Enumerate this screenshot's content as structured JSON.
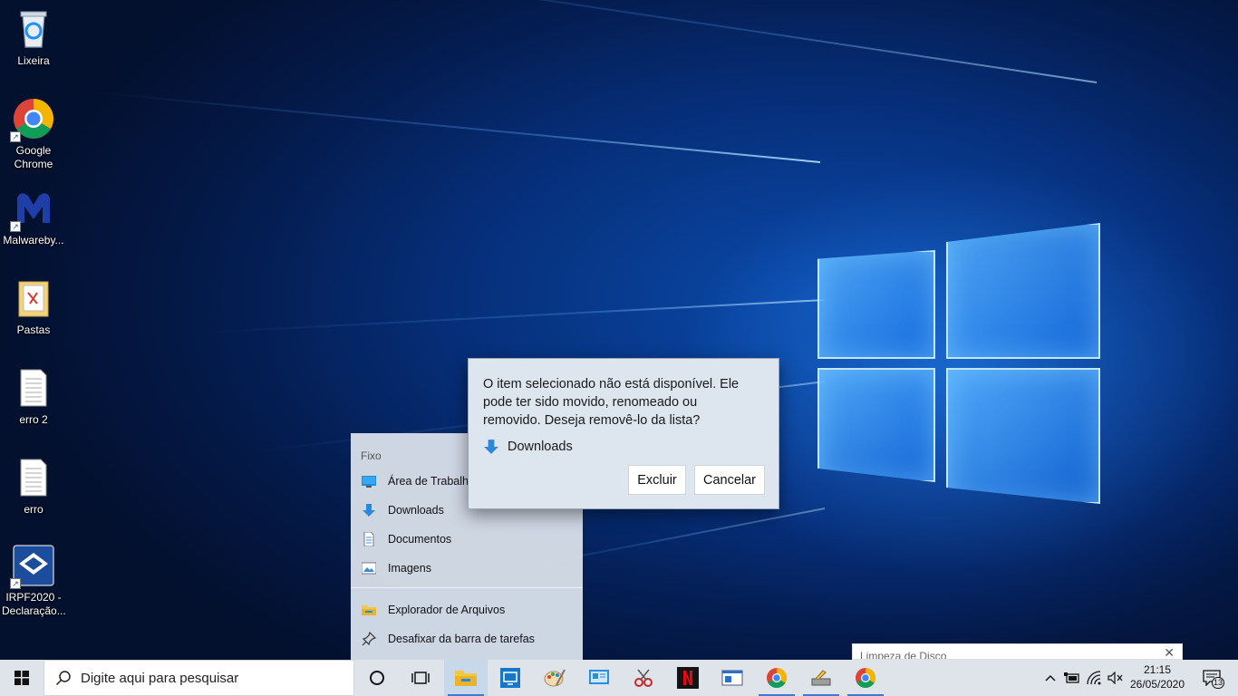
{
  "desktop": {
    "icons": [
      {
        "label": "Lixeira"
      },
      {
        "label": "Google Chrome"
      },
      {
        "label": "Malwareby..."
      },
      {
        "label": "Pastas"
      },
      {
        "label": "erro 2"
      },
      {
        "label": "erro"
      },
      {
        "label": "IRPF2020 - Declaração..."
      }
    ]
  },
  "jumplist": {
    "section_title": "Fixo",
    "pinned": [
      {
        "label": "Área de Trabalho",
        "icon": "desktop-icon"
      },
      {
        "label": "Downloads",
        "icon": "download-arrow-icon"
      },
      {
        "label": "Documentos",
        "icon": "document-icon"
      },
      {
        "label": "Imagens",
        "icon": "pictures-icon"
      }
    ],
    "tasks": [
      {
        "label": "Explorador de Arquivos",
        "icon": "folder-icon"
      },
      {
        "label": "Desafixar da barra de tarefas",
        "icon": "unpin-icon"
      }
    ]
  },
  "dialog": {
    "message": "O item selecionado não está disponível. Ele pode ter sido movido, renomeado ou removido. Deseja removê-lo da lista?",
    "item_label": "Downloads",
    "item_icon": "download-arrow-icon",
    "delete_label": "Excluir",
    "cancel_label": "Cancelar"
  },
  "notification": {
    "title": "Limpeza de Disco"
  },
  "taskbar": {
    "search_placeholder": "Digite aqui para pesquisar",
    "apps": [
      "cortana-icon",
      "task-view-icon",
      "file-explorer-icon",
      "remote-desktop-icon",
      "paint-icon",
      "control-panel-icon",
      "snipping-tool-icon",
      "netflix-icon",
      "window-app-icon",
      "chrome-icon",
      "disk-cleanup-icon",
      "chrome-icon"
    ],
    "clock_time": "21:15",
    "clock_date": "26/05/2020",
    "notification_count": "13"
  },
  "colors": {
    "accent": "#0078d7",
    "taskbar": "#dfe4ea",
    "dialog_bg": "#dde5ee",
    "netflix": "#e50914"
  }
}
